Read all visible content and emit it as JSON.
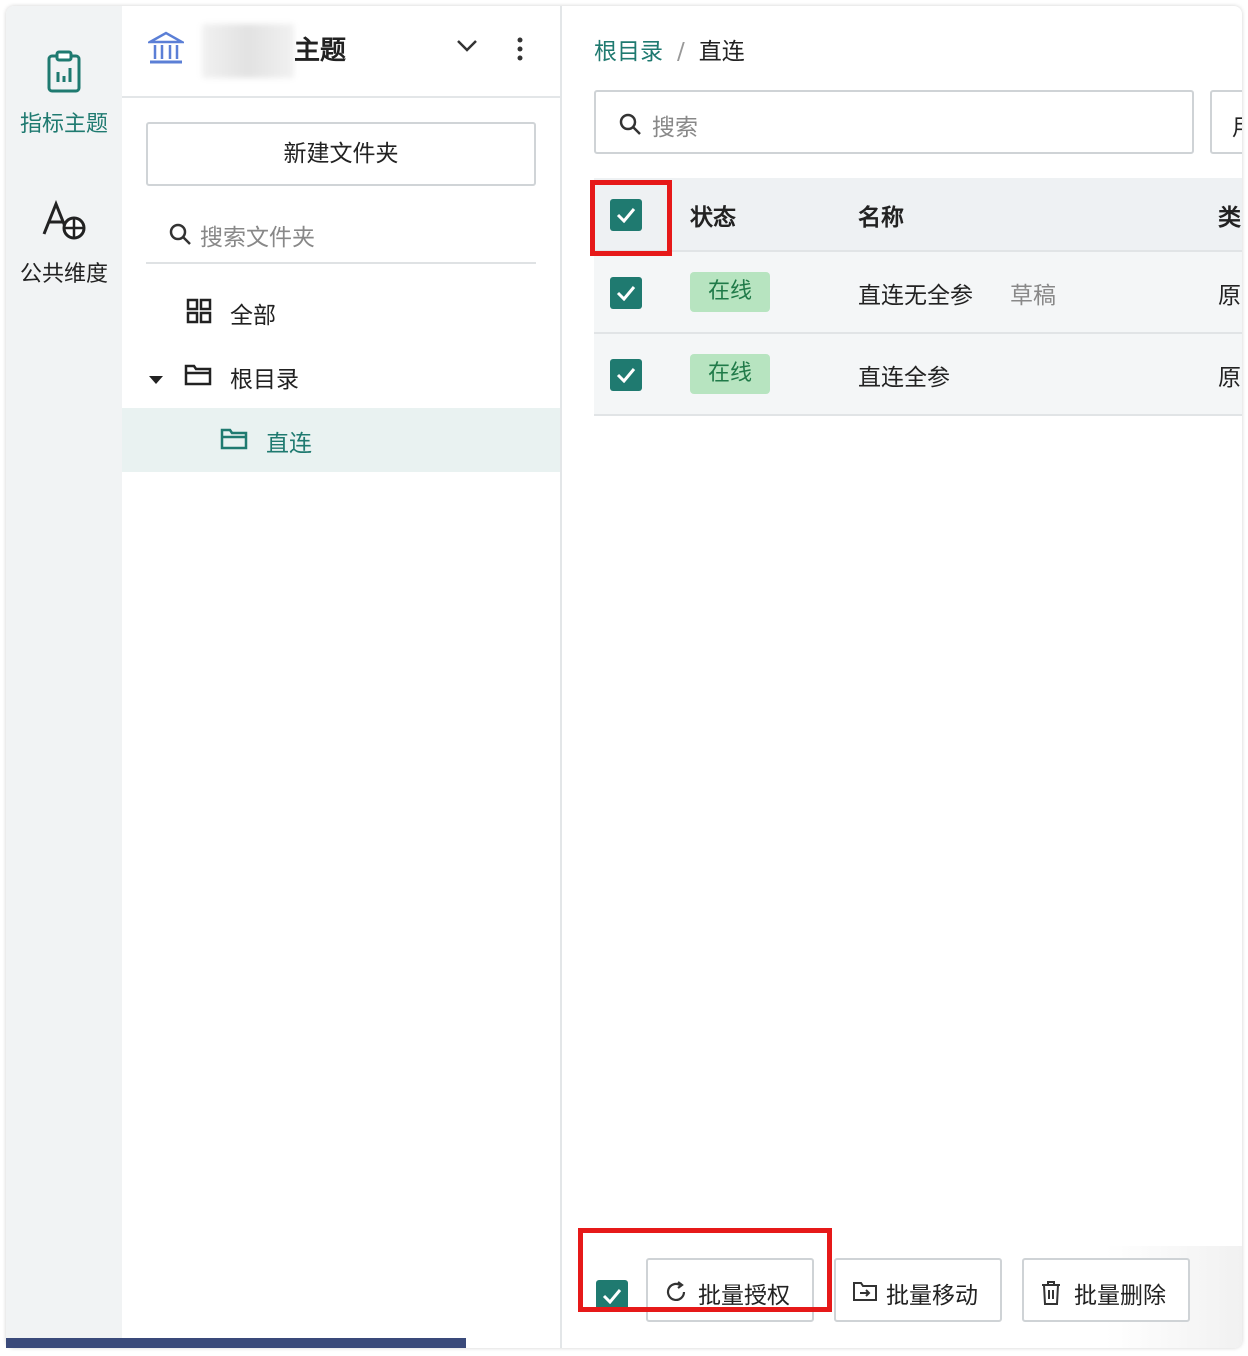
{
  "rail": {
    "items": [
      {
        "label": "指标主题",
        "icon": "clipboard-chart-icon",
        "active": true
      },
      {
        "label": "公共维度",
        "icon": "text-globe-icon",
        "active": false
      }
    ]
  },
  "folder_pane": {
    "title": "主题",
    "new_folder_label": "新建文件夹",
    "search_placeholder": "搜索文件夹",
    "tree": [
      {
        "label": "全部",
        "icon": "grid-icon"
      },
      {
        "label": "根目录",
        "icon": "folder-icon",
        "expanded": true
      },
      {
        "label": "直连",
        "icon": "folder-open-icon",
        "selected": true
      }
    ]
  },
  "main": {
    "breadcrumb": {
      "root": "根目录",
      "separator": "/",
      "current": "直连"
    },
    "search_placeholder": "搜索",
    "side_button_label": "用",
    "table": {
      "headers": {
        "status": "状态",
        "name": "名称",
        "type": "类"
      },
      "rows": [
        {
          "checked": true,
          "status": "在线",
          "name": "直连无全参",
          "draft": "草稿",
          "type": "原"
        },
        {
          "checked": true,
          "status": "在线",
          "name": "直连全参",
          "draft": "",
          "type": "原"
        }
      ]
    },
    "bottom_actions": {
      "authorize": "批量授权",
      "move": "批量移动",
      "delete": "批量删除"
    }
  },
  "colors": {
    "accent": "#1f7a70",
    "highlight": "#e61919",
    "badge_bg": "#b7e4c0"
  }
}
